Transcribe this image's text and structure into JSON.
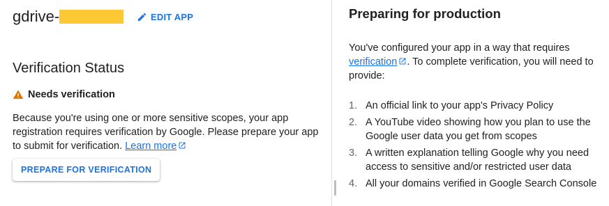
{
  "app": {
    "title": "gdrive-",
    "edit_label": "EDIT APP"
  },
  "verification": {
    "heading": "Verification Status",
    "status": "Needs verification",
    "description": "Because you're using one or more sensitive scopes, your app registration requires verification by Google. Please prepare your app to submit for verification.",
    "learn_more": "Learn more",
    "button_label": "PREPARE FOR VERIFICATION"
  },
  "production": {
    "heading": "Preparing for production",
    "intro_before": "You've configured your app in a way that requires",
    "intro_link": "verification",
    "intro_after": ". To complete verification, you will need to provide:",
    "steps": [
      {
        "num": "1.",
        "text": "An official link to your app's Privacy Policy"
      },
      {
        "num": "2.",
        "text": "A YouTube video showing how you plan to use the Google user data you get from scopes"
      },
      {
        "num": "3.",
        "text": "A written explanation telling Google why you need access to sensitive and/or restricted user data"
      },
      {
        "num": "4.",
        "text": "All your domains verified in Google Search Console"
      }
    ]
  },
  "colors": {
    "accent": "#1a73e8",
    "warning": "#e37400",
    "redaction": "#fcc934"
  },
  "icons": [
    "edit-icon",
    "warning-icon",
    "external-link-icon"
  ]
}
